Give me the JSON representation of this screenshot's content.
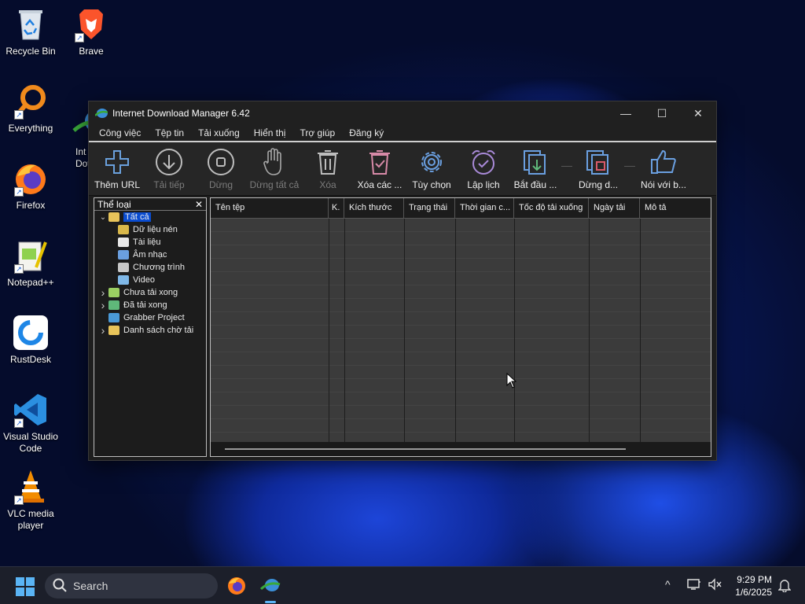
{
  "desktop": {
    "icons": [
      {
        "label": "Recycle Bin"
      },
      {
        "label": "Brave"
      },
      {
        "label": "Everything"
      },
      {
        "label": "Int\nDov"
      },
      {
        "label": "Firefox"
      },
      {
        "label": "Notepad++"
      },
      {
        "label": "RustDesk"
      },
      {
        "label": "Visual Studio Code"
      },
      {
        "label": "VLC media player"
      }
    ]
  },
  "window": {
    "title": "Internet Download Manager 6.42",
    "controls": {
      "minimize": "—",
      "maximize": "☐",
      "close": "✕"
    }
  },
  "menu": [
    "Công việc",
    "Tệp tin",
    "Tải xuống",
    "Hiển thị",
    "Trợ giúp",
    "Đăng ký"
  ],
  "toolbar": [
    {
      "label": "Thêm URL",
      "icon": "plus-icon",
      "enabled": true
    },
    {
      "label": "Tải tiếp",
      "icon": "resume-download-icon",
      "enabled": false
    },
    {
      "label": "Dừng",
      "icon": "stop-icon",
      "enabled": false
    },
    {
      "label": "Dừng tất cả",
      "icon": "hand-stop-icon",
      "enabled": false
    },
    {
      "label": "Xóa",
      "icon": "trash-icon",
      "enabled": false
    },
    {
      "label": "Xóa các ...",
      "icon": "delete-completed-icon",
      "enabled": true
    },
    {
      "label": "Tùy chọn",
      "icon": "gear-icon",
      "enabled": true
    },
    {
      "label": "Lập lịch",
      "icon": "alarm-clock-icon",
      "enabled": true
    },
    {
      "label": "Bắt đầu ...",
      "icon": "start-queue-icon",
      "enabled": true
    },
    {
      "label": "Dừng d...",
      "icon": "stop-queue-icon",
      "enabled": true
    },
    {
      "label": "Nói với b...",
      "icon": "thumbs-up-icon",
      "enabled": true
    }
  ],
  "categories": {
    "header": "Thể loại",
    "close": "✕",
    "items": [
      {
        "label": "Tất cả",
        "level": 0,
        "expand": "open",
        "icon": "folder-open-icon",
        "selected": true
      },
      {
        "label": "Dữ liệu nén",
        "level": 1,
        "icon": "archive-icon"
      },
      {
        "label": "Tài liệu",
        "level": 1,
        "icon": "document-icon"
      },
      {
        "label": "Âm nhạc",
        "level": 1,
        "icon": "music-icon"
      },
      {
        "label": "Chương trình",
        "level": 1,
        "icon": "program-icon"
      },
      {
        "label": "Video",
        "level": 1,
        "icon": "video-icon"
      },
      {
        "label": "Chưa tải xong",
        "level": 0,
        "expand": "closed",
        "icon": "unfinished-folder-icon"
      },
      {
        "label": "Đã tải xong",
        "level": 0,
        "expand": "closed",
        "icon": "finished-folder-icon"
      },
      {
        "label": "Grabber Project",
        "level": 0,
        "expand": "none",
        "icon": "grabber-icon"
      },
      {
        "label": "Danh sách chờ tải",
        "level": 0,
        "expand": "closed",
        "icon": "queue-folder-icon"
      }
    ]
  },
  "file_list": {
    "columns": [
      "Tên tệp",
      "K.",
      "Kích thước",
      "Trạng thái",
      "Thời gian c...",
      "Tốc độ tải xuống",
      "Ngày tải",
      "Mô tả"
    ],
    "rows": []
  },
  "taskbar": {
    "search_label": "Search",
    "apps": [
      "firefox-icon",
      "idm-icon"
    ]
  },
  "tray": {
    "chevron": "^",
    "time": "9:29 PM",
    "date": "1/6/2025"
  },
  "colors": {
    "accent": "#0a4cd0",
    "window_bg": "#1e1e1e",
    "taskbar_bg": "#1c1f2a",
    "icon_blue": "#6a9fe0"
  }
}
